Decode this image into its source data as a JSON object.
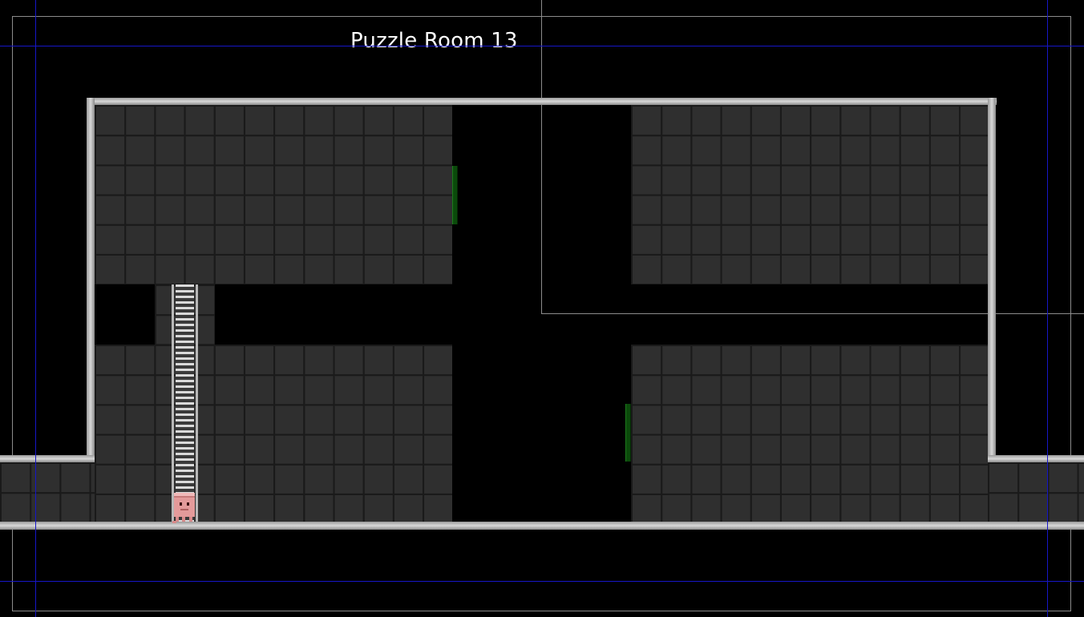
{
  "room": {
    "title": "Puzzle Room 13"
  },
  "colors": {
    "background": "#000000",
    "tile": "#2f2f2f",
    "wall": "#c8c8c8",
    "door": "#0b4a0b",
    "guide_line": "#1616c8",
    "camera_frame": "#8c8c8c",
    "player": "#e8a0a0"
  },
  "entities": {
    "player": {
      "icon": "pink-block-character-icon"
    },
    "ladder": {
      "icon": "ladder-icon"
    },
    "doors": [
      {
        "name": "green-door-upper"
      },
      {
        "name": "green-door-lower"
      }
    ]
  }
}
